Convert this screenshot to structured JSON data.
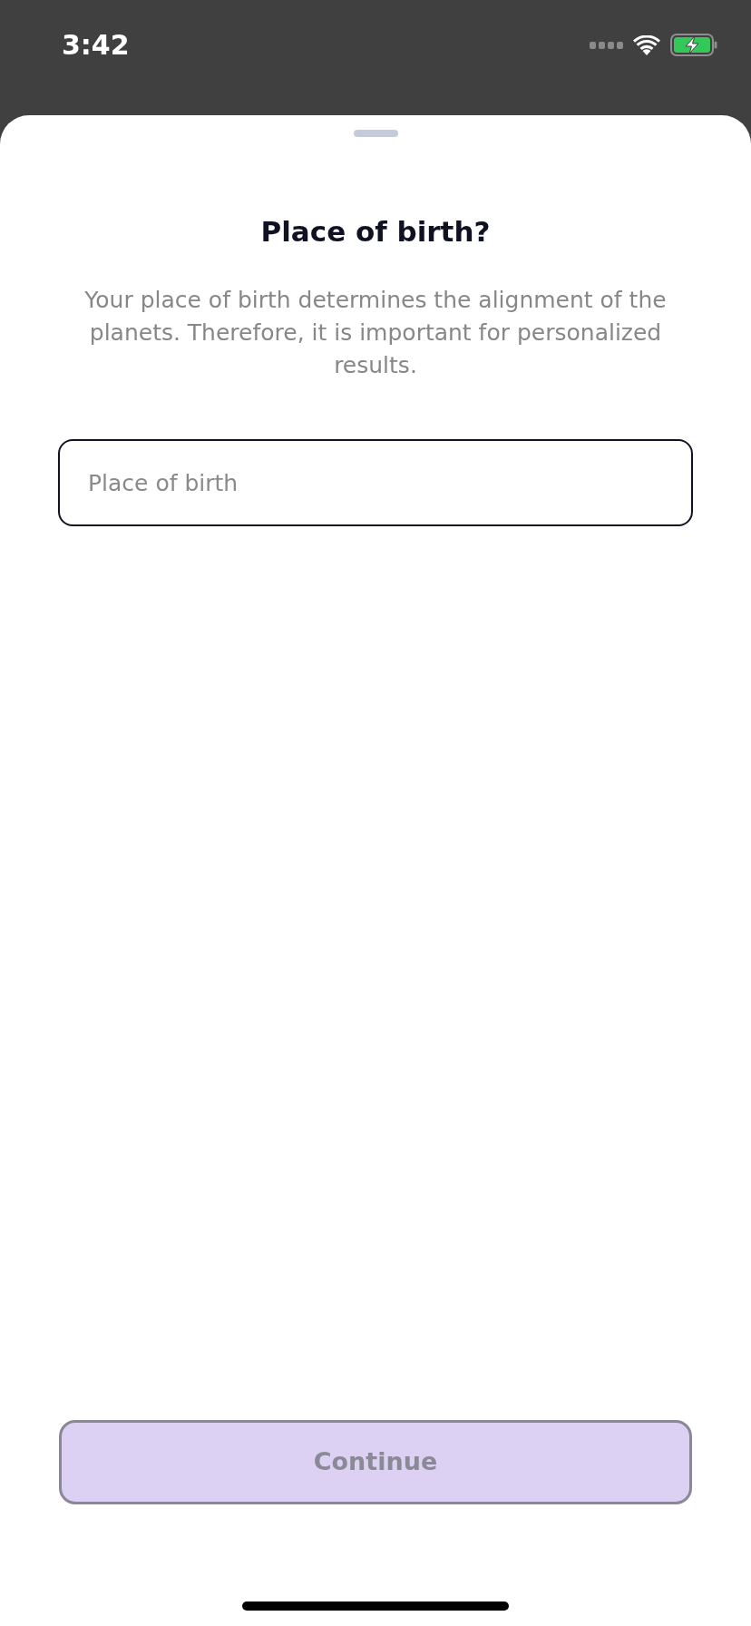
{
  "status_bar": {
    "time": "3:42"
  },
  "sheet": {
    "title": "Place of birth?",
    "description": "Your place of birth determines the alignment of the planets. Therefore, it is important for personalized results.",
    "field": {
      "placeholder": "Place of birth"
    },
    "continue_button": {
      "label": "Continue",
      "disabled": true
    }
  }
}
